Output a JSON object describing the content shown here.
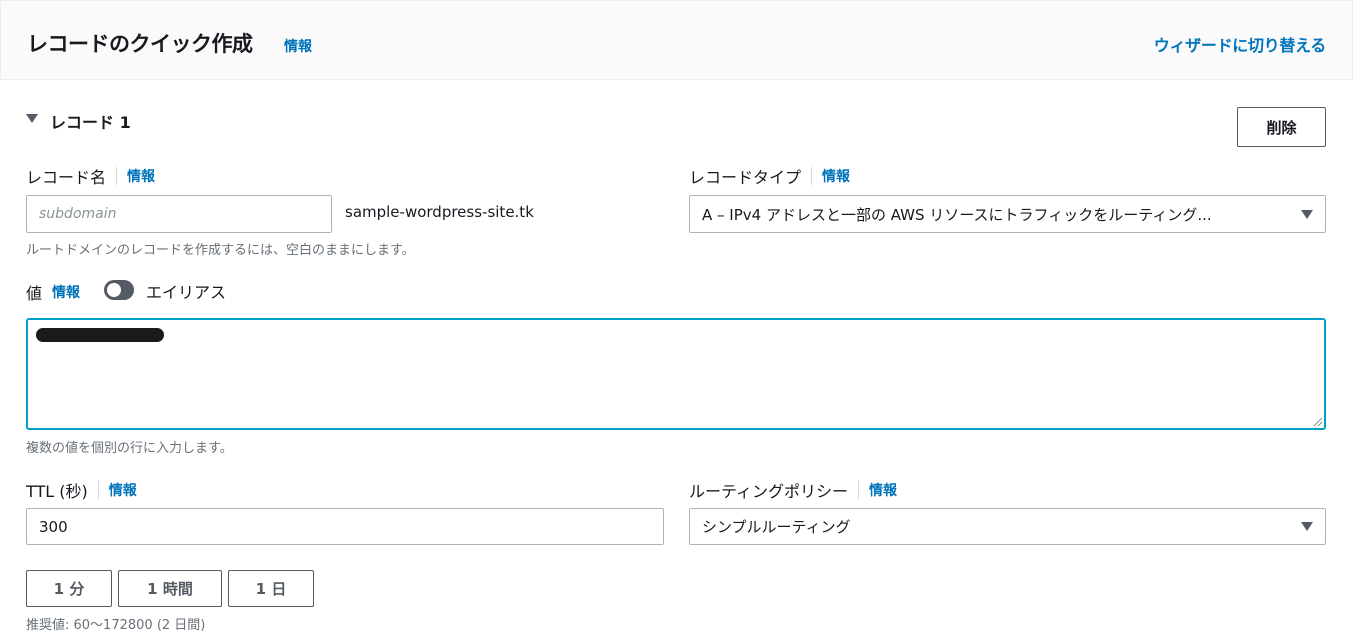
{
  "header": {
    "title": "レコードのクイック作成",
    "info": "情報",
    "wizard_link": "ウィザードに切り替える"
  },
  "record": {
    "heading": "レコード 1",
    "delete_label": "削除"
  },
  "record_name": {
    "label": "レコード名",
    "info": "情報",
    "placeholder": "subdomain",
    "domain_suffix": "sample-wordpress-site.tk",
    "hint": "ルートドメインのレコードを作成するには、空白のままにします。"
  },
  "record_type": {
    "label": "レコードタイプ",
    "info": "情報",
    "value": "A – IPv4 アドレスと一部の AWS リソースにトラフィックをルーティング..."
  },
  "value": {
    "label": "値",
    "info": "情報",
    "alias_label": "エイリアス",
    "alias_enabled": false,
    "hint": "複数の値を個別の行に入力します。"
  },
  "ttl": {
    "label": "TTL (秒)",
    "info": "情報",
    "value": "300",
    "buttons": [
      "1 分",
      "1 時間",
      "1 日"
    ],
    "hint": "推奨値: 60～172800 (2 日間)"
  },
  "routing_policy": {
    "label": "ルーティングポリシー",
    "info": "情報",
    "value": "シンプルルーティング"
  },
  "colors": {
    "link": "#0073bb",
    "focus_border": "#00a1c9",
    "text": "#16191f"
  }
}
